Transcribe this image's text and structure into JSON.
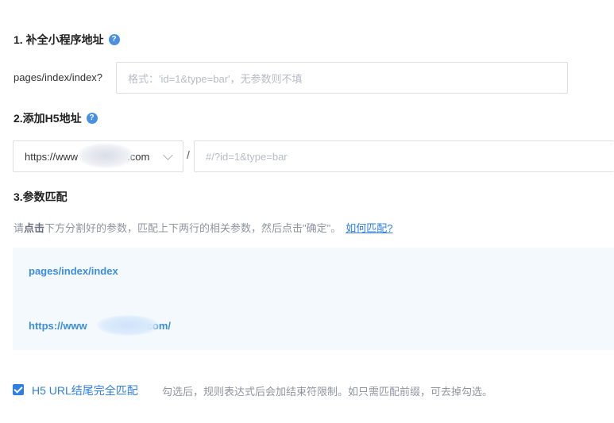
{
  "section1": {
    "title": "1. 补全小程序地址",
    "help_icon": "question-circle-icon",
    "path_label": "pages/index/index?",
    "query_placeholder": "格式：'id=1&type=bar'，无参数则不填"
  },
  "section2": {
    "title": "2.添加H5地址",
    "help_icon": "question-circle-icon",
    "domain_prefix": "https://www",
    "domain_suffix": ".com",
    "separator": "/",
    "path_placeholder": "#/?id=1&type=bar"
  },
  "section3": {
    "title": "3.参数匹配",
    "hint_prefix": "请",
    "hint_bold": "点击",
    "hint_rest": "下方分割好的参数，匹配上下两行的相关参数，然后点击\"确定\"。",
    "hint_link": "如何匹配?",
    "mini_path": "pages/index/index",
    "h5_prefix": "https://www",
    "h5_suffix": "com/"
  },
  "options": {
    "exact_match_checked": true,
    "exact_match_label": "H5 URL结尾完全匹配",
    "exact_match_note": "勾选后，规则表达式后会加结束符限制。如只需匹配前缀，可去掉勾选。"
  },
  "colors": {
    "accent": "#2f7fe0",
    "match_text": "#3d8ce0",
    "panel_bg": "#f4f9fe"
  }
}
